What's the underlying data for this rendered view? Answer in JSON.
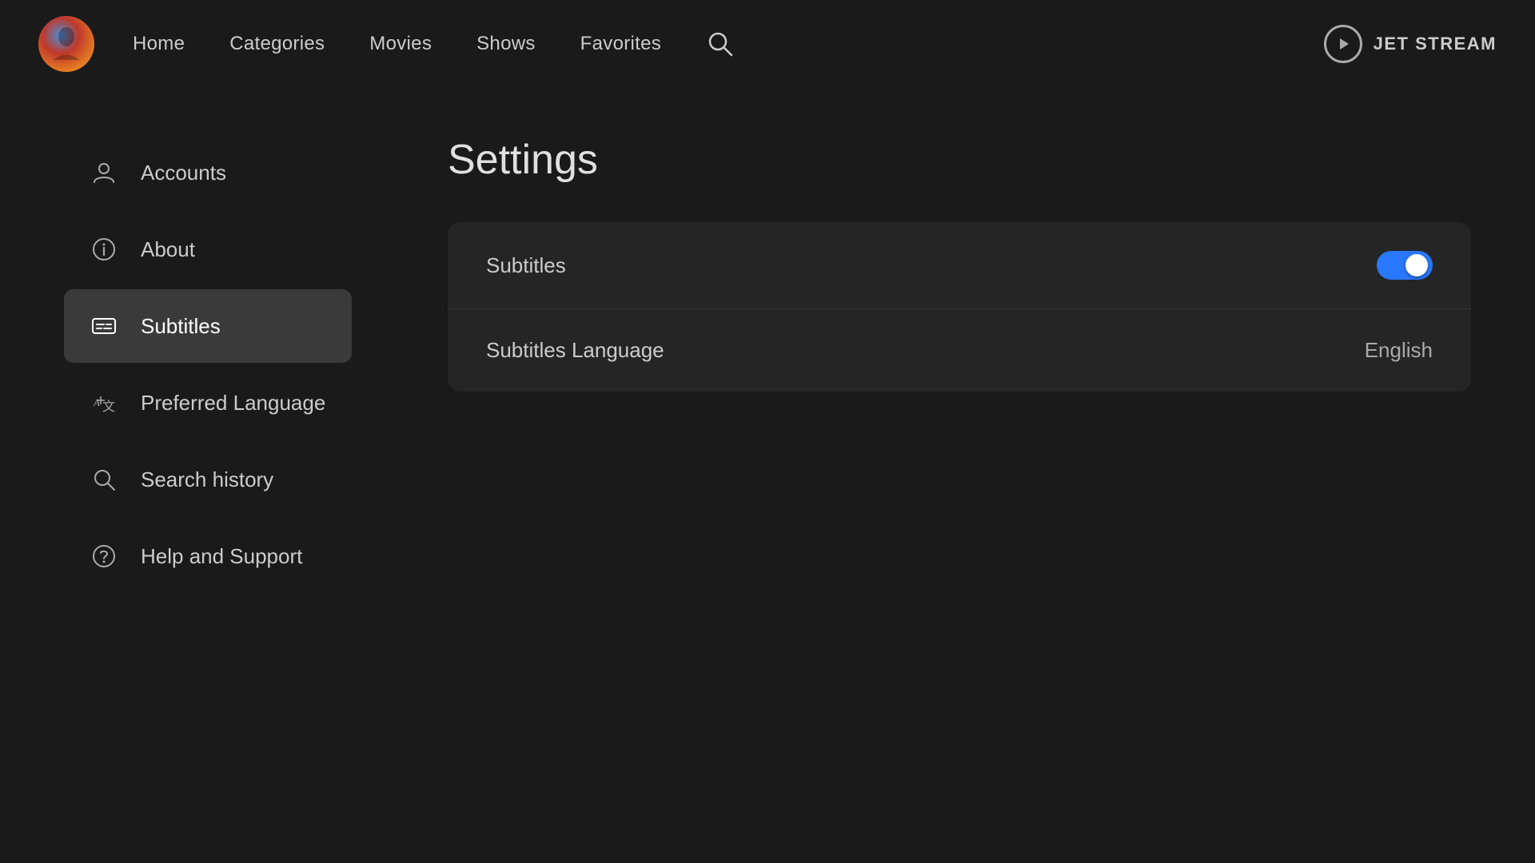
{
  "header": {
    "brand": "JET STREAM",
    "nav": {
      "items": [
        {
          "label": "Home",
          "id": "home"
        },
        {
          "label": "Categories",
          "id": "categories"
        },
        {
          "label": "Movies",
          "id": "movies"
        },
        {
          "label": "Shows",
          "id": "shows"
        },
        {
          "label": "Favorites",
          "id": "favorites"
        }
      ]
    }
  },
  "sidebar": {
    "items": [
      {
        "id": "accounts",
        "label": "Accounts",
        "icon": "person"
      },
      {
        "id": "about",
        "label": "About",
        "icon": "info"
      },
      {
        "id": "subtitles",
        "label": "Subtitles",
        "icon": "subtitles",
        "active": true
      },
      {
        "id": "preferred-language",
        "label": "Preferred Language",
        "icon": "translate"
      },
      {
        "id": "search-history",
        "label": "Search history",
        "icon": "search"
      },
      {
        "id": "help-support",
        "label": "Help and Support",
        "icon": "help"
      }
    ]
  },
  "settings": {
    "title": "Settings",
    "rows": [
      {
        "id": "subtitles-toggle",
        "label": "Subtitles",
        "type": "toggle",
        "value": true
      },
      {
        "id": "subtitles-language",
        "label": "Subtitles Language",
        "type": "value",
        "value": "English"
      }
    ]
  },
  "colors": {
    "accent": "#2979ff",
    "bg": "#1a1a1a",
    "sidebar_active": "#3a3a3a",
    "card_bg": "#252525"
  }
}
